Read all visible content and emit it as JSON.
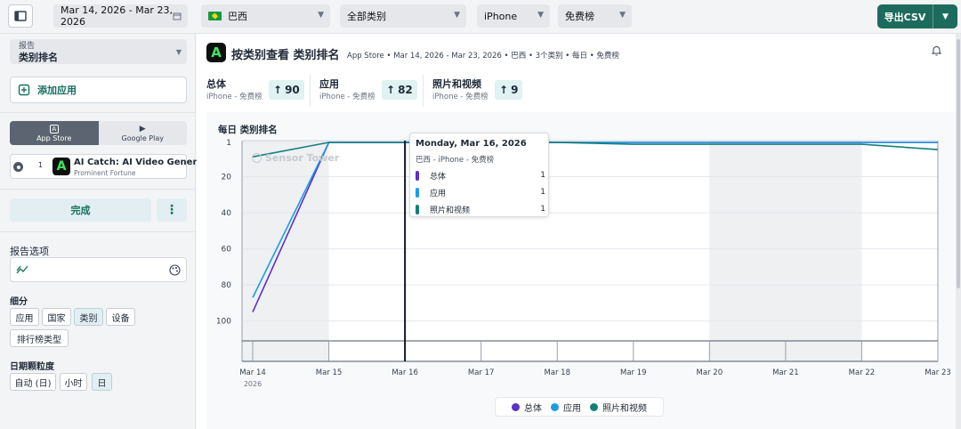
{
  "topbar": {
    "date_range": "Mar 14, 2026 - Mar 23, 2026",
    "country": "巴西",
    "category": "全部类别",
    "device": "iPhone",
    "chart_type": "免费榜",
    "export_label": "导出CSV"
  },
  "sidebar": {
    "report_label": "报告",
    "report_value": "类别排名",
    "add_app": "添加应用",
    "store_tabs": [
      "App Store",
      "Google Play"
    ],
    "app": {
      "rank": "1",
      "name": "AI Catch: AI Video Genera...",
      "publisher": "Prominent Fortune"
    },
    "done": "完成",
    "report_options": "报告选项",
    "breakdown_label": "细分",
    "breakdown_chips": [
      "应用",
      "国家",
      "类别",
      "设备",
      "排行榜类型"
    ],
    "granularity_label": "日期颗粒度",
    "granularity_chips": [
      "自动 (日)",
      "小时",
      "日"
    ]
  },
  "header": {
    "title": "按类别查看 类别排名",
    "meta": "App Store • Mar 14, 2026 - Mar 23, 2026 • 巴西 • 3个类别 • 每日 • 免费榜"
  },
  "stats": [
    {
      "name": "总体",
      "sub": "iPhone - 免费榜",
      "value": "90"
    },
    {
      "name": "应用",
      "sub": "iPhone - 免费榜",
      "value": "82"
    },
    {
      "name": "照片和视频",
      "sub": "iPhone - 免费榜",
      "value": "9"
    }
  ],
  "chart_title": "每日 类别排名",
  "watermark": "Sensor Tower",
  "tooltip": {
    "date": "Monday, Mar 16, 2026",
    "sub": "巴西 - iPhone - 免费榜",
    "rows": [
      {
        "name": "总体",
        "value": "1"
      },
      {
        "name": "应用",
        "value": "1"
      },
      {
        "name": "照片和视频",
        "value": "1"
      }
    ]
  },
  "colors": {
    "accent": "#1d6b5c",
    "overall": "#5b2fc9",
    "apps": "#1e9be8",
    "photo": "#14807a"
  },
  "chart_data": {
    "type": "line",
    "title": "每日 类别排名",
    "x": [
      "Mar 14",
      "Mar 15",
      "Mar 16",
      "Mar 17",
      "Mar 18",
      "Mar 19",
      "Mar 20",
      "Mar 21",
      "Mar 22",
      "Mar 23"
    ],
    "x_year_label": "2026",
    "y_ticks": [
      1,
      20,
      40,
      60,
      80,
      100
    ],
    "ylim": [
      1,
      110
    ],
    "y_reversed": true,
    "series": [
      {
        "name": "总体",
        "values": [
          95,
          1,
          1,
          1,
          1,
          1,
          1,
          1,
          1,
          1
        ]
      },
      {
        "name": "应用",
        "values": [
          87,
          1,
          1,
          1,
          1,
          1,
          1,
          1,
          1,
          1
        ]
      },
      {
        "name": "照片和视频",
        "values": [
          9,
          1,
          1,
          1,
          1,
          2,
          2,
          2,
          2,
          5
        ]
      }
    ],
    "legend": [
      "总体",
      "应用",
      "照片和视频"
    ],
    "legend_position": "bottom"
  }
}
